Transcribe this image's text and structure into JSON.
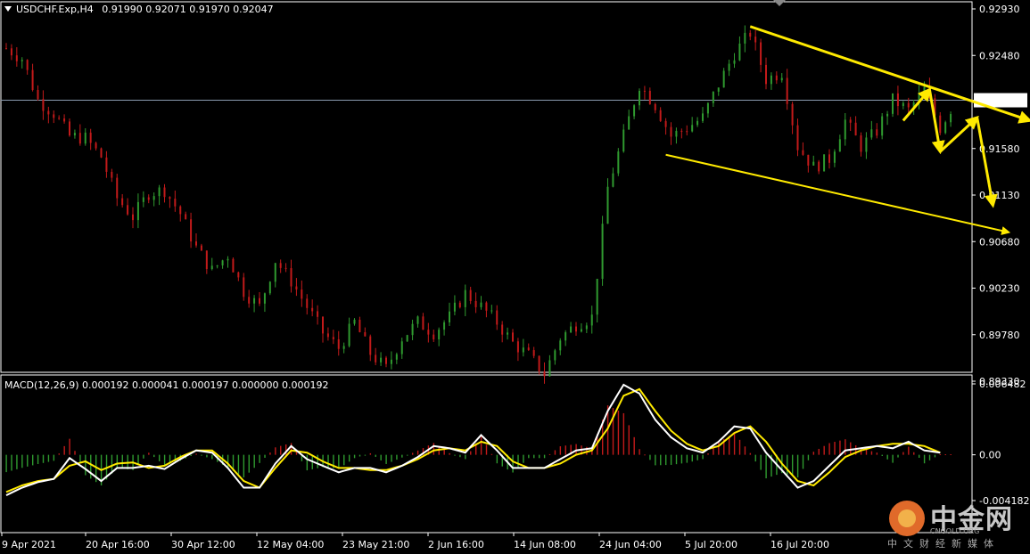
{
  "header": {
    "symbol": "USDCHF.Exp,H4",
    "ohlc": "0.91990 0.92071 0.91970 0.92047"
  },
  "macd_header": {
    "text": "MACD(12,26,9) 0.000192 0.000041 0.000197 0.000000 0.000192"
  },
  "colors": {
    "background": "#000000",
    "bull": "#2f9a2f",
    "bear": "#c21a1a",
    "trendline": "#ffea00",
    "macd_main": "#ffffff",
    "macd_signal": "#ffea00",
    "grid_frame": "#ffffff",
    "current_price_line": "#8a9bb0"
  },
  "watermark": {
    "brand": "中金网",
    "site": "CNGOLD.ORG",
    "tagline": "中文财经新媒体"
  },
  "chart_data": [
    {
      "type": "candlestick",
      "title": "USDCHF.Exp,H4",
      "current_price": 0.92047,
      "ylim": [
        0.9915,
        0.9316
      ],
      "price_scale_ticks": [
        "0.92930",
        "0.92480",
        "0.92047",
        "0.91580",
        "0.91130",
        "0.90680",
        "0.90230",
        "0.89780",
        "0.89330"
      ],
      "time_labels": [
        "9 Apr 2021",
        "20 Apr 16:00",
        "30 Apr 12:00",
        "12 May 04:00",
        "23 May 21:00",
        "2 Jun 16:00",
        "14 Jun 08:00",
        "24 Jun 04:00",
        "5 Jul 20:00",
        "16 Jul 20:00"
      ],
      "close_path": [
        [
          0,
          0.9255
        ],
        [
          3,
          0.9245
        ],
        [
          6,
          0.9205
        ],
        [
          9,
          0.9192
        ],
        [
          12,
          0.917
        ],
        [
          15,
          0.9168
        ],
        [
          18,
          0.915
        ],
        [
          21,
          0.911
        ],
        [
          24,
          0.9092
        ],
        [
          27,
          0.9115
        ],
        [
          30,
          0.9118
        ],
        [
          33,
          0.9095
        ],
        [
          36,
          0.9062
        ],
        [
          39,
          0.904
        ],
        [
          42,
          0.9055
        ],
        [
          45,
          0.902
        ],
        [
          48,
          0.9005
        ],
        [
          51,
          0.905
        ],
        [
          54,
          0.903
        ],
        [
          57,
          0.9005
        ],
        [
          60,
          0.898
        ],
        [
          63,
          0.8965
        ],
        [
          66,
          0.899
        ],
        [
          69,
          0.896
        ],
        [
          72,
          0.8945
        ],
        [
          75,
          0.8975
        ],
        [
          78,
          0.899
        ],
        [
          81,
          0.898
        ],
        [
          84,
          0.8995
        ],
        [
          87,
          0.9018
        ],
        [
          90,
          0.9005
        ],
        [
          93,
          0.899
        ],
        [
          96,
          0.897
        ],
        [
          99,
          0.8958
        ],
        [
          102,
          0.894
        ],
        [
          105,
          0.8975
        ],
        [
          108,
          0.8988
        ],
        [
          111,
          0.8995
        ],
        [
          114,
          0.912
        ],
        [
          117,
          0.917
        ],
        [
          120,
          0.922
        ],
        [
          123,
          0.92
        ],
        [
          126,
          0.917
        ],
        [
          129,
          0.9178
        ],
        [
          132,
          0.9188
        ],
        [
          135,
          0.922
        ],
        [
          138,
          0.925
        ],
        [
          141,
          0.927
        ],
        [
          144,
          0.9225
        ],
        [
          147,
          0.9232
        ],
        [
          150,
          0.916
        ],
        [
          153,
          0.914
        ],
        [
          156,
          0.9148
        ],
        [
          159,
          0.9185
        ],
        [
          162,
          0.916
        ],
        [
          165,
          0.9175
        ],
        [
          168,
          0.9205
        ],
        [
          171,
          0.9195
        ],
        [
          174,
          0.9215
        ],
        [
          177,
          0.9178
        ],
        [
          180,
          0.9205
        ]
      ],
      "trendlines": [
        {
          "name": "upper",
          "from": [
            141,
            0.9276
          ],
          "to": [
            194,
            0.9185
          ],
          "arrow": true
        },
        {
          "name": "lower",
          "from": [
            125,
            0.9152
          ],
          "to": [
            190,
            0.9077
          ],
          "arrow": true
        }
      ],
      "projection_arrows": [
        [
          [
            170,
            0.9185
          ],
          [
            175,
            0.9215
          ]
        ],
        [
          [
            175,
            0.9215
          ],
          [
            177,
            0.9155
          ]
        ],
        [
          [
            177,
            0.9155
          ],
          [
            184,
            0.9188
          ]
        ],
        [
          [
            184,
            0.9188
          ],
          [
            187,
            0.9103
          ]
        ]
      ]
    },
    {
      "type": "macd",
      "title": "MACD(12,26,9)",
      "params": [
        12,
        26,
        9
      ],
      "values_readout": [
        0.000192,
        4.1e-05,
        0.000197,
        0.0,
        0.000192
      ],
      "ylim": [
        -0.004182,
        0.006482
      ],
      "price_scale_ticks": [
        "0.006482",
        "0.00",
        "-0.004182"
      ],
      "main_path": [
        [
          0,
          -0.0037
        ],
        [
          3,
          -0.003
        ],
        [
          6,
          -0.0025
        ],
        [
          9,
          -0.0022
        ],
        [
          12,
          -0.0003
        ],
        [
          15,
          -0.0013
        ],
        [
          18,
          -0.0024
        ],
        [
          21,
          -0.0012
        ],
        [
          24,
          -0.0012
        ],
        [
          27,
          -0.001
        ],
        [
          30,
          -0.0013
        ],
        [
          33,
          -0.0004
        ],
        [
          36,
          0.0004
        ],
        [
          39,
          0.0002
        ],
        [
          42,
          -0.0012
        ],
        [
          45,
          -0.003
        ],
        [
          48,
          -0.003
        ],
        [
          51,
          -0.0008
        ],
        [
          54,
          0.0008
        ],
        [
          57,
          -0.0004
        ],
        [
          60,
          -0.001
        ],
        [
          63,
          -0.0016
        ],
        [
          66,
          -0.0012
        ],
        [
          69,
          -0.0012
        ],
        [
          72,
          -0.0016
        ],
        [
          75,
          -0.001
        ],
        [
          78,
          -0.0002
        ],
        [
          81,
          0.0008
        ],
        [
          84,
          0.0006
        ],
        [
          87,
          0.0002
        ],
        [
          90,
          0.0018
        ],
        [
          93,
          0.0004
        ],
        [
          96,
          -0.0012
        ],
        [
          99,
          -0.0012
        ],
        [
          102,
          -0.0012
        ],
        [
          105,
          -0.0004
        ],
        [
          108,
          0.0004
        ],
        [
          111,
          0.0006
        ],
        [
          114,
          0.004
        ],
        [
          117,
          0.0064
        ],
        [
          120,
          0.0056
        ],
        [
          123,
          0.0032
        ],
        [
          126,
          0.0016
        ],
        [
          129,
          0.0006
        ],
        [
          132,
          0.0002
        ],
        [
          135,
          0.0012
        ],
        [
          138,
          0.0026
        ],
        [
          141,
          0.0024
        ],
        [
          144,
          0.0002
        ],
        [
          147,
          -0.0014
        ],
        [
          150,
          -0.003
        ],
        [
          153,
          -0.0024
        ],
        [
          156,
          -0.001
        ],
        [
          159,
          0.0004
        ],
        [
          162,
          0.0006
        ],
        [
          165,
          0.0008
        ],
        [
          168,
          0.0006
        ],
        [
          171,
          0.0012
        ],
        [
          174,
          0.0004
        ],
        [
          177,
          0.0002
        ]
      ],
      "signal_path": [
        [
          0,
          -0.0034
        ],
        [
          3,
          -0.0028
        ],
        [
          6,
          -0.0024
        ],
        [
          9,
          -0.0022
        ],
        [
          12,
          -0.001
        ],
        [
          15,
          -0.0006
        ],
        [
          18,
          -0.0014
        ],
        [
          21,
          -0.0008
        ],
        [
          24,
          -0.0007
        ],
        [
          27,
          -0.0012
        ],
        [
          30,
          -0.001
        ],
        [
          33,
          -0.0002
        ],
        [
          36,
          0.0004
        ],
        [
          39,
          0.0004
        ],
        [
          42,
          -0.0008
        ],
        [
          45,
          -0.0024
        ],
        [
          48,
          -0.003
        ],
        [
          51,
          -0.0012
        ],
        [
          54,
          0.0004
        ],
        [
          57,
          0.0002
        ],
        [
          60,
          -0.0006
        ],
        [
          63,
          -0.0012
        ],
        [
          66,
          -0.0012
        ],
        [
          69,
          -0.0014
        ],
        [
          72,
          -0.0014
        ],
        [
          75,
          -0.001
        ],
        [
          78,
          -0.0004
        ],
        [
          81,
          0.0004
        ],
        [
          84,
          0.0006
        ],
        [
          87,
          0.0004
        ],
        [
          90,
          0.0012
        ],
        [
          93,
          0.0008
        ],
        [
          96,
          -0.0006
        ],
        [
          99,
          -0.0012
        ],
        [
          102,
          -0.0012
        ],
        [
          105,
          -0.0008
        ],
        [
          108,
          0.0
        ],
        [
          111,
          0.0004
        ],
        [
          114,
          0.0024
        ],
        [
          117,
          0.0054
        ],
        [
          120,
          0.006
        ],
        [
          123,
          0.004
        ],
        [
          126,
          0.0022
        ],
        [
          129,
          0.001
        ],
        [
          132,
          0.0004
        ],
        [
          135,
          0.0008
        ],
        [
          138,
          0.002
        ],
        [
          141,
          0.0026
        ],
        [
          144,
          0.0012
        ],
        [
          147,
          -0.0008
        ],
        [
          150,
          -0.0024
        ],
        [
          153,
          -0.0028
        ],
        [
          156,
          -0.0016
        ],
        [
          159,
          -0.0002
        ],
        [
          162,
          0.0004
        ],
        [
          165,
          0.0008
        ],
        [
          168,
          0.001
        ],
        [
          171,
          0.001
        ],
        [
          174,
          0.0008
        ],
        [
          177,
          0.0002
        ]
      ]
    }
  ]
}
